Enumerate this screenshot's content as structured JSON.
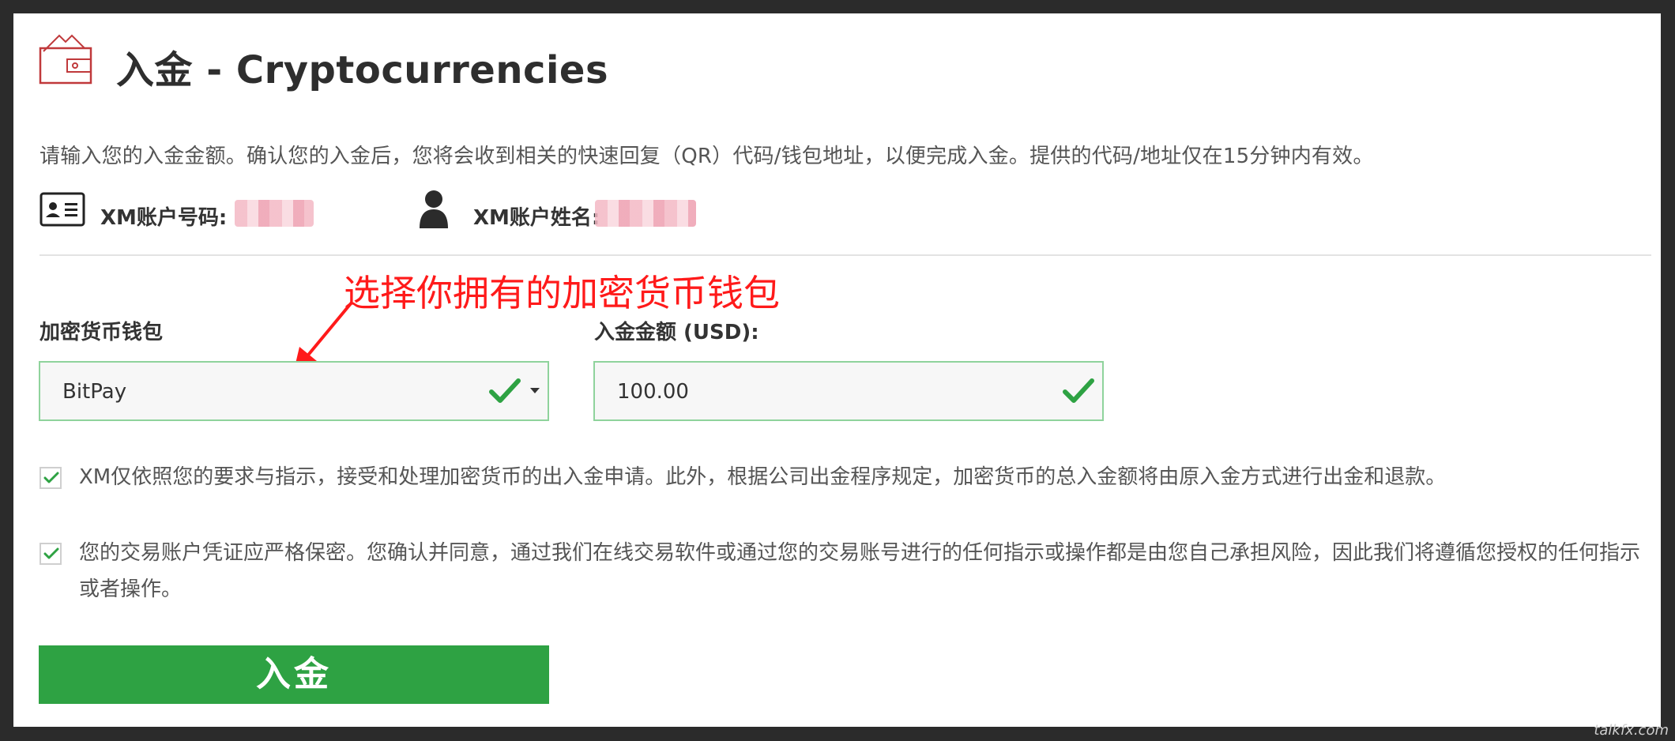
{
  "header": {
    "title": "入金 - Cryptocurrencies"
  },
  "intro_text": "请输入您的入金金额。确认您的入金后，您将会收到相关的快速回复（QR）代码/钱包地址，以便完成入金。提供的代码/地址仅在15分钟内有效。",
  "account": {
    "number_label": "XM账户号码:",
    "name_label": "XM账户姓名:"
  },
  "annotation": "选择你拥有的加密货币钱包",
  "form": {
    "wallet_label": "加密货币钱包",
    "wallet_value": "BitPay",
    "amount_label": "入金金额 (USD):",
    "amount_value": "100.00"
  },
  "terms": {
    "term1": "XM仅依照您的要求与指示，接受和处理加密货币的出入金申请。此外，根据公司出金程序规定，加密货币的总入金额将由原入金方式进行出金和退款。",
    "term2": "您的交易账户凭证应严格保密。您确认并同意，通过我们在线交易软件或通过您的交易账号进行的任何指示或操作都是由您自己承担风险，因此我们将遵循您授权的任何指示或者操作。"
  },
  "submit_label": "入金",
  "watermark": "talkfx.com",
  "colors": {
    "accent_green": "#2ea243",
    "valid_border": "#8fd39c",
    "annotation_red": "#ff1a1a",
    "icon_red": "#c0393b"
  },
  "icons": {
    "wallet": "wallet-icon",
    "id_card": "id-card-icon",
    "user": "user-icon",
    "check": "check-icon"
  }
}
